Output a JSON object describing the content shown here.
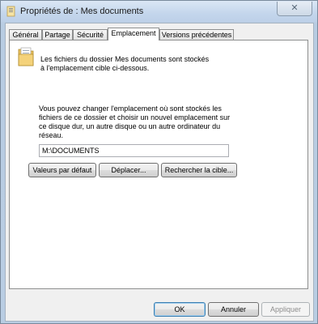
{
  "window": {
    "title": "Propriétés de : Mes documents",
    "close_label": "✕"
  },
  "tabs": [
    {
      "label": "Général"
    },
    {
      "label": "Partage"
    },
    {
      "label": "Sécurité"
    },
    {
      "label": "Emplacement"
    },
    {
      "label": "Versions précédentes"
    }
  ],
  "panel": {
    "intro_line1": "Les fichiers du dossier Mes documents sont stockés",
    "intro_line2": "à l'emplacement cible ci-dessous.",
    "desc_line1": "Vous pouvez changer l'emplacement où sont stockés les",
    "desc_line2": "fichiers de ce dossier et choisir un nouvel emplacement sur",
    "desc_line3": "ce disque dur, un autre disque ou un autre ordinateur du",
    "desc_line4": "réseau.",
    "path_value": "M:\\DOCUMENTS",
    "buttons": {
      "restore_default": "Valeurs par défaut",
      "move": "Déplacer...",
      "find_target": "Rechercher la cible..."
    }
  },
  "footer": {
    "ok": "OK",
    "cancel": "Annuler",
    "apply": "Appliquer"
  },
  "active_tab": "Emplacement",
  "colors": {
    "title_bar": "#c4d6ec",
    "panel_bg": "#ffffff",
    "dialog_bg": "#f0f0f0",
    "folder_yellow": "#f4d27a"
  },
  "icons": {
    "title": "folder-icon",
    "panel": "folder-icon",
    "close": "close-icon"
  }
}
